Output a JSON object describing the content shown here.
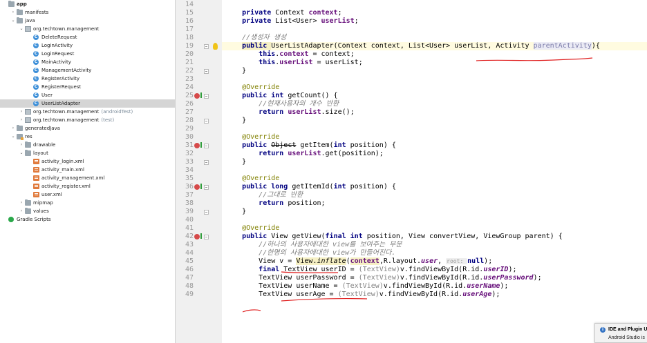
{
  "project_tree": [
    {
      "label": "app",
      "suffix": "",
      "icon": "folder",
      "depth": 0,
      "arrow": "",
      "selected": false,
      "bold": true
    },
    {
      "label": "manifests",
      "suffix": "",
      "icon": "folder",
      "depth": 1,
      "arrow": "›",
      "selected": false
    },
    {
      "label": "java",
      "suffix": "",
      "icon": "folder",
      "depth": 1,
      "arrow": "⌄",
      "selected": false
    },
    {
      "label": "org.techtown.management",
      "suffix": "",
      "icon": "package",
      "depth": 2,
      "arrow": "⌄",
      "selected": false
    },
    {
      "label": "DeleteRequest",
      "suffix": "",
      "icon": "class",
      "depth": 3,
      "arrow": "",
      "selected": false
    },
    {
      "label": "LoginActivity",
      "suffix": "",
      "icon": "class",
      "depth": 3,
      "arrow": "",
      "selected": false
    },
    {
      "label": "LoginRequest",
      "suffix": "",
      "icon": "class",
      "depth": 3,
      "arrow": "",
      "selected": false
    },
    {
      "label": "MainActivity",
      "suffix": "",
      "icon": "class",
      "depth": 3,
      "arrow": "",
      "selected": false
    },
    {
      "label": "ManagementActivity",
      "suffix": "",
      "icon": "class",
      "depth": 3,
      "arrow": "",
      "selected": false
    },
    {
      "label": "RegisterActivity",
      "suffix": "",
      "icon": "class",
      "depth": 3,
      "arrow": "",
      "selected": false
    },
    {
      "label": "RegisterRequest",
      "suffix": "",
      "icon": "class",
      "depth": 3,
      "arrow": "",
      "selected": false
    },
    {
      "label": "User",
      "suffix": "",
      "icon": "class",
      "depth": 3,
      "arrow": "",
      "selected": false
    },
    {
      "label": "UserListAdapter",
      "suffix": "",
      "icon": "class",
      "depth": 3,
      "arrow": "",
      "selected": true
    },
    {
      "label": "org.techtown.management",
      "suffix": "(androidTest)",
      "icon": "package",
      "depth": 2,
      "arrow": "›",
      "selected": false
    },
    {
      "label": "org.techtown.management",
      "suffix": "(test)",
      "icon": "package",
      "depth": 2,
      "arrow": "›",
      "selected": false
    },
    {
      "label": "generatedJava",
      "suffix": "",
      "icon": "folder",
      "depth": 1,
      "arrow": "›",
      "selected": false
    },
    {
      "label": "res",
      "suffix": "",
      "icon": "res",
      "depth": 1,
      "arrow": "⌄",
      "selected": false
    },
    {
      "label": "drawable",
      "suffix": "",
      "icon": "folder",
      "depth": 2,
      "arrow": "›",
      "selected": false
    },
    {
      "label": "layout",
      "suffix": "",
      "icon": "folder",
      "depth": 2,
      "arrow": "⌄",
      "selected": false
    },
    {
      "label": "activity_login.xml",
      "suffix": "",
      "icon": "xml",
      "depth": 3,
      "arrow": "",
      "selected": false
    },
    {
      "label": "activity_main.xml",
      "suffix": "",
      "icon": "xml",
      "depth": 3,
      "arrow": "",
      "selected": false
    },
    {
      "label": "activity_management.xml",
      "suffix": "",
      "icon": "xml",
      "depth": 3,
      "arrow": "",
      "selected": false
    },
    {
      "label": "activity_register.xml",
      "suffix": "",
      "icon": "xml",
      "depth": 3,
      "arrow": "",
      "selected": false
    },
    {
      "label": "user.xml",
      "suffix": "",
      "icon": "xml",
      "depth": 3,
      "arrow": "",
      "selected": false
    },
    {
      "label": "mipmap",
      "suffix": "",
      "icon": "folder",
      "depth": 2,
      "arrow": "›",
      "selected": false
    },
    {
      "label": "values",
      "suffix": "",
      "icon": "folder",
      "depth": 2,
      "arrow": "›",
      "selected": false
    },
    {
      "label": "Gradle Scripts",
      "suffix": "",
      "icon": "gradle",
      "depth": 0,
      "arrow": "",
      "selected": false
    }
  ],
  "code_lines": [
    {
      "num": "14",
      "marks": [],
      "segs": []
    },
    {
      "num": "15",
      "marks": [],
      "segs": [
        [
          "    ",
          ""
        ],
        [
          "private ",
          "kw"
        ],
        [
          "Context ",
          ""
        ],
        [
          "context",
          "fld"
        ],
        [
          ";",
          ""
        ]
      ]
    },
    {
      "num": "16",
      "marks": [],
      "segs": [
        [
          "    ",
          ""
        ],
        [
          "private ",
          "kw"
        ],
        [
          "List<User> ",
          ""
        ],
        [
          "userList",
          "fld"
        ],
        [
          ";",
          ""
        ]
      ]
    },
    {
      "num": "17",
      "marks": [],
      "segs": []
    },
    {
      "num": "18",
      "marks": [],
      "segs": [
        [
          "    ",
          ""
        ],
        [
          "//생성자 생성",
          "cmt"
        ]
      ]
    },
    {
      "num": "19",
      "marks": [
        "fold",
        "bulb"
      ],
      "current": true,
      "segs": [
        [
          "    ",
          ""
        ],
        [
          "public ",
          "kw warnbg"
        ],
        [
          "UserListAdapter(Context context, List<User> userList, Activity ",
          ""
        ],
        [
          "parentActivity",
          "unused"
        ],
        [
          "){",
          ""
        ]
      ]
    },
    {
      "num": "20",
      "marks": [],
      "segs": [
        [
          "        ",
          ""
        ],
        [
          "this",
          "kw"
        ],
        [
          ".",
          ""
        ],
        [
          "context",
          "fld"
        ],
        [
          " = context;",
          ""
        ]
      ]
    },
    {
      "num": "21",
      "marks": [],
      "segs": [
        [
          "        ",
          ""
        ],
        [
          "this",
          "kw"
        ],
        [
          ".",
          ""
        ],
        [
          "userList",
          "fld"
        ],
        [
          " = userList;",
          ""
        ]
      ]
    },
    {
      "num": "22",
      "marks": [
        "fold"
      ],
      "segs": [
        [
          "    }",
          ""
        ]
      ]
    },
    {
      "num": "23",
      "marks": [],
      "segs": []
    },
    {
      "num": "24",
      "marks": [],
      "segs": [
        [
          "    ",
          ""
        ],
        [
          "@Override",
          "ann"
        ]
      ]
    },
    {
      "num": "25",
      "marks": [
        "override",
        "fold"
      ],
      "segs": [
        [
          "    ",
          ""
        ],
        [
          "public int ",
          "kw"
        ],
        [
          "getCount() {",
          ""
        ]
      ]
    },
    {
      "num": "26",
      "marks": [],
      "segs": [
        [
          "        ",
          ""
        ],
        [
          "//현재사용자의 개수 반환",
          "cmt"
        ]
      ]
    },
    {
      "num": "27",
      "marks": [],
      "segs": [
        [
          "        ",
          ""
        ],
        [
          "return ",
          "kw"
        ],
        [
          "userList",
          "fld"
        ],
        [
          ".size();",
          ""
        ]
      ]
    },
    {
      "num": "28",
      "marks": [
        "fold"
      ],
      "segs": [
        [
          "    }",
          ""
        ]
      ]
    },
    {
      "num": "29",
      "marks": [],
      "segs": []
    },
    {
      "num": "30",
      "marks": [],
      "segs": [
        [
          "    ",
          ""
        ],
        [
          "@Override",
          "ann"
        ]
      ]
    },
    {
      "num": "31",
      "marks": [
        "override",
        "fold"
      ],
      "segs": [
        [
          "    ",
          ""
        ],
        [
          "public ",
          "kw"
        ],
        [
          "Object",
          "strike"
        ],
        [
          " getItem(",
          ""
        ],
        [
          "int ",
          "kw"
        ],
        [
          "position) {",
          ""
        ]
      ]
    },
    {
      "num": "32",
      "marks": [],
      "segs": [
        [
          "        ",
          ""
        ],
        [
          "return ",
          "kw"
        ],
        [
          "userList",
          "fld"
        ],
        [
          ".get(position);",
          ""
        ]
      ]
    },
    {
      "num": "33",
      "marks": [
        "fold"
      ],
      "segs": [
        [
          "    }",
          ""
        ]
      ]
    },
    {
      "num": "34",
      "marks": [],
      "segs": []
    },
    {
      "num": "35",
      "marks": [],
      "segs": [
        [
          "    ",
          ""
        ],
        [
          "@Override",
          "ann"
        ]
      ]
    },
    {
      "num": "36",
      "marks": [
        "override",
        "fold"
      ],
      "segs": [
        [
          "    ",
          ""
        ],
        [
          "public long ",
          "kw"
        ],
        [
          "getItemId(",
          ""
        ],
        [
          "int ",
          "kw"
        ],
        [
          "position) {",
          ""
        ]
      ]
    },
    {
      "num": "37",
      "marks": [],
      "segs": [
        [
          "        ",
          ""
        ],
        [
          "//그대로 반환",
          "cmt"
        ]
      ]
    },
    {
      "num": "38",
      "marks": [],
      "segs": [
        [
          "        ",
          ""
        ],
        [
          "return ",
          "kw"
        ],
        [
          "position;",
          ""
        ]
      ]
    },
    {
      "num": "39",
      "marks": [
        "fold"
      ],
      "segs": [
        [
          "    }",
          ""
        ]
      ]
    },
    {
      "num": "40",
      "marks": [],
      "segs": []
    },
    {
      "num": "41",
      "marks": [],
      "segs": [
        [
          "    ",
          ""
        ],
        [
          "@Override",
          "ann"
        ]
      ]
    },
    {
      "num": "42",
      "marks": [
        "override",
        "fold"
      ],
      "segs": [
        [
          "    ",
          ""
        ],
        [
          "public ",
          "kw"
        ],
        [
          "View getView(",
          ""
        ],
        [
          "final int ",
          "kw"
        ],
        [
          "position, View convertView, ViewGroup parent) {",
          ""
        ]
      ]
    },
    {
      "num": "43",
      "marks": [],
      "segs": [
        [
          "        ",
          ""
        ],
        [
          "//하나의 사용자에대한 view를 보여주는 부분",
          "cmt"
        ]
      ]
    },
    {
      "num": "44",
      "marks": [],
      "segs": [
        [
          "        ",
          ""
        ],
        [
          "//한명의 사용자에대한 view가 만들어진다.",
          "cmt"
        ]
      ]
    },
    {
      "num": "45",
      "marks": [],
      "segs": [
        [
          "        View v = ",
          ""
        ],
        [
          "View.",
          "warnbg"
        ],
        [
          "inflate",
          "stat warnbg"
        ],
        [
          "(",
          ""
        ],
        [
          "context",
          "fld warnbg"
        ],
        [
          ",R.layout.",
          ""
        ],
        [
          "user",
          "fldi"
        ],
        [
          ", ",
          ""
        ],
        [
          "root: ",
          "hint"
        ],
        [
          "null",
          "kw"
        ],
        [
          ");",
          ""
        ]
      ]
    },
    {
      "num": "46",
      "marks": [],
      "segs": [
        [
          "        ",
          ""
        ],
        [
          "final ",
          "kw"
        ],
        [
          "TextView userID = ",
          ""
        ],
        [
          "(TextView)",
          "grey"
        ],
        [
          "v.findViewById(R.id.",
          ""
        ],
        [
          "userID",
          "fldi"
        ],
        [
          ");",
          ""
        ]
      ]
    },
    {
      "num": "47",
      "marks": [],
      "segs": [
        [
          "        TextView userPassword = ",
          ""
        ],
        [
          "(TextView)",
          "grey"
        ],
        [
          "v.findViewById(R.id.",
          ""
        ],
        [
          "userPassword",
          "fldi"
        ],
        [
          ");",
          ""
        ]
      ]
    },
    {
      "num": "48",
      "marks": [],
      "segs": [
        [
          "        TextView userName = ",
          ""
        ],
        [
          "(TextView)",
          "grey"
        ],
        [
          "v.findViewById(R.id.",
          ""
        ],
        [
          "userName",
          "fldi"
        ],
        [
          ");",
          ""
        ]
      ]
    },
    {
      "num": "49",
      "marks": [],
      "segs": [
        [
          "        TextView userAge = ",
          ""
        ],
        [
          "(TextView)",
          "grey"
        ],
        [
          "v.findViewById(R.id.",
          ""
        ],
        [
          "userAge",
          "fldi"
        ],
        [
          ");",
          ""
        ]
      ]
    }
  ],
  "notification": {
    "title": "IDE and Plugin Up",
    "body": "Android Studio is"
  },
  "colors": {
    "keyword": "#000080",
    "field": "#660e7a",
    "comment": "#808080",
    "annotation": "#808000",
    "selection": "#d5d5d5",
    "annotation_marks": "#e02020"
  }
}
